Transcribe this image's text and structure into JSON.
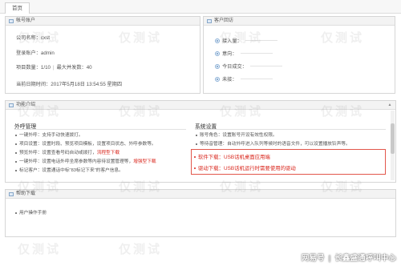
{
  "tabs": [
    {
      "label": "首页"
    }
  ],
  "account_panel": {
    "title": "帐号账户",
    "rows": [
      {
        "text": "公司名称：cxst"
      },
      {
        "text": "登录账户：admin"
      },
      {
        "parts": [
          "项目数量：1/10",
          "最大并发数：40"
        ]
      },
      {
        "text": "当前日期时间：2017年5月18日 13:54:55 星期四"
      }
    ]
  },
  "todo_panel": {
    "title": "客户回访",
    "items": [
      {
        "label": "接入量："
      },
      {
        "label": "意向："
      },
      {
        "label": "今日成交："
      },
      {
        "label": "未接："
      }
    ]
  },
  "function_panel": {
    "title": "功能介绍",
    "business": {
      "title": "外呼管理",
      "items": [
        {
          "text": "一键外呼：支持手动快速拨打。",
          "tag": ""
        },
        {
          "text": "项目设置：设置时段、预览项目模板，设置项目状态、外呼参数等。",
          "tag": ""
        },
        {
          "text": "预览外呼：设置查看号码自动或拨打，",
          "tag": "流程型下载"
        },
        {
          "text": "一键外呼：设置电话外呼坐席参数等内容待设置管理等，",
          "tag": "增强型下载"
        },
        {
          "text": "标记客户：设置通话中标\"83标记下来\"的客户信息。",
          "tag": ""
        }
      ]
    },
    "system": {
      "title": "系统设置",
      "items": [
        {
          "text": "账号角色：设置账号开设有效性权限。"
        },
        {
          "text": "等待音管理：自动外呼进入队列等候时的语音文件，可以设置播放铃声等。"
        }
      ],
      "highlight": [
        {
          "text": "软件下载：USB话机桌面应用端"
        },
        {
          "text": "驱动下载：USB话机运行时需要使用的驱动"
        }
      ]
    }
  },
  "help_panel": {
    "title": "帮助下载",
    "items": [
      {
        "text": "用户操作手册"
      }
    ]
  },
  "watermark": {
    "text": "仅测试"
  },
  "corner": {
    "site": "网易号",
    "brand": "长鑫盛通呼叫中心"
  },
  "colors": {
    "accent_red": "#d9261c",
    "panel_header": "#f3f3f3",
    "border": "#d6d6d6"
  }
}
